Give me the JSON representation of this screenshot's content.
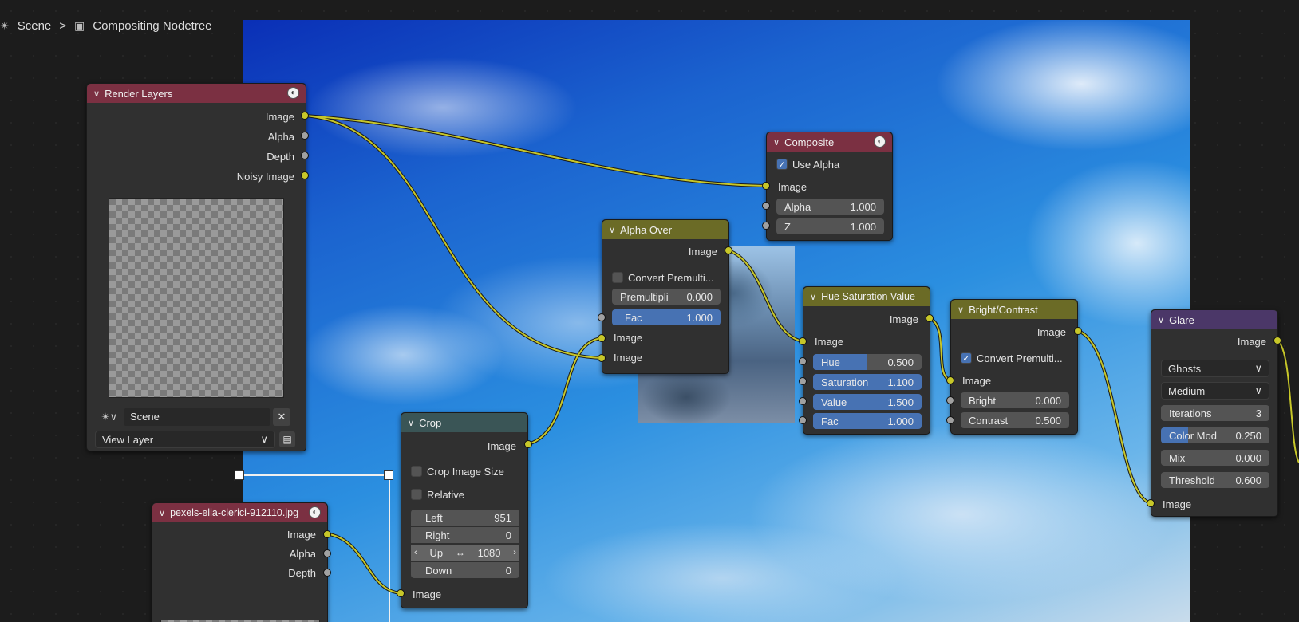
{
  "breadcrumb": {
    "scene": "Scene",
    "separator": ">",
    "nodetree": "Compositing Nodetree"
  },
  "render_layers": {
    "title": "Render Layers",
    "outputs": [
      "Image",
      "Alpha",
      "Depth",
      "Noisy Image"
    ],
    "scene_field": "Scene",
    "view_layer": "View Layer"
  },
  "image_node": {
    "title": "pexels-elia-clerici-912110.jpg",
    "outputs": [
      "Image",
      "Alpha",
      "Depth"
    ]
  },
  "crop": {
    "title": "Crop",
    "output": "Image",
    "crop_image_size": "Crop Image Size",
    "relative": "Relative",
    "left_label": "Left",
    "left_value": "951",
    "right_label": "Right",
    "right_value": "0",
    "up_label": "Up",
    "up_value": "1080",
    "down_label": "Down",
    "down_value": "0",
    "input": "Image"
  },
  "alpha_over": {
    "title": "Alpha Over",
    "output": "Image",
    "convert": "Convert Premulti...",
    "premul_label": "Premultipli",
    "premul_value": "0.000",
    "fac_label": "Fac",
    "fac_value": "1.000",
    "inputs": [
      "Image",
      "Image"
    ]
  },
  "composite": {
    "title": "Composite",
    "use_alpha": "Use Alpha",
    "input": "Image",
    "alpha_label": "Alpha",
    "alpha_value": "1.000",
    "z_label": "Z",
    "z_value": "1.000"
  },
  "hsv": {
    "title": "Hue Saturation Value",
    "output": "Image",
    "input": "Image",
    "hue_label": "Hue",
    "hue_value": "0.500",
    "sat_label": "Saturation",
    "sat_value": "1.100",
    "val_label": "Value",
    "val_value": "1.500",
    "fac_label": "Fac",
    "fac_value": "1.000"
  },
  "bright": {
    "title": "Bright/Contrast",
    "output": "Image",
    "convert": "Convert Premulti...",
    "input": "Image",
    "bright_label": "Bright",
    "bright_value": "0.000",
    "contrast_label": "Contrast",
    "contrast_value": "0.500"
  },
  "glare": {
    "title": "Glare",
    "output": "Image",
    "type": "Ghosts",
    "quality": "Medium",
    "iterations_label": "Iterations",
    "iterations_value": "3",
    "colormod_label": "Color Mod",
    "colormod_value": "0.250",
    "mix_label": "Mix",
    "mix_value": "0.000",
    "threshold_label": "Threshold",
    "threshold_value": "0.600",
    "input": "Image"
  },
  "colors": {
    "wire": "#c7c729",
    "header_render": "#7b3042",
    "header_color": "#6b6b26",
    "header_distort": "#3a5556",
    "header_filter": "#4b3768",
    "field_active": "#4772b3"
  }
}
